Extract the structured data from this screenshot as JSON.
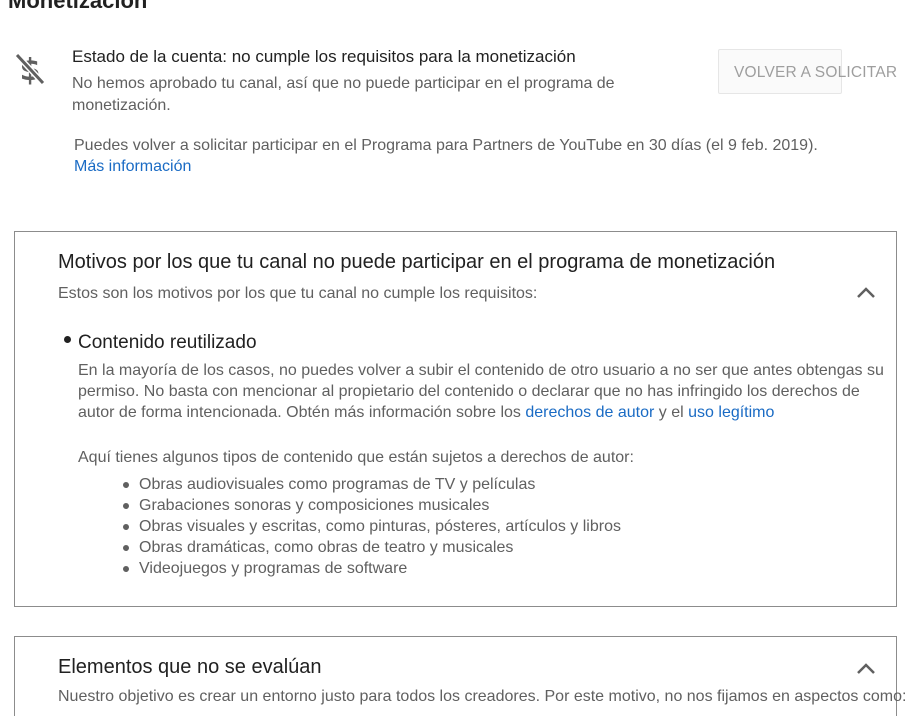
{
  "page": {
    "title": "Monetización"
  },
  "status": {
    "icon": "no-money-icon",
    "title": "Estado de la cuenta: no cumple los requisitos para la monetización",
    "description": "No hemos aprobado tu canal, así que no puede participar en el programa de monetización.",
    "reapply_label": "VOLVER A SOLICITAR",
    "reapply_note": "Puedes volver a solicitar participar en el Programa para Partners de YouTube en 30 días (el 9 feb. 2019).",
    "more_info_label": "Más información"
  },
  "reasons_card": {
    "title": "Motivos por los que tu canal no puede participar en el programa de monetización",
    "subtitle": "Estos son los motivos por los que tu canal no cumple los requisitos:",
    "reason": {
      "title": "Contenido reutilizado",
      "body": "En la mayoría de los casos, no puedes volver a subir el contenido de otro usuario a no ser que antes obtengas su permiso. No basta con mencionar al propietario del contenido o declarar que no has infringido los derechos de autor de forma intencionada. Obtén más información sobre los ",
      "copyright_link": "derechos de autor",
      "connector": " y el ",
      "fair_use_link": "uso legítimo",
      "examples_intro": "Aquí tienes algunos tipos de contenido que están sujetos a derechos de autor:",
      "examples": [
        "Obras audiovisuales como programas de TV y películas",
        "Grabaciones sonoras y composiciones musicales",
        "Obras visuales y escritas, como pinturas, pósteres, artículos y libros",
        "Obras dramáticas, como obras de teatro y musicales",
        "Videojuegos y programas de software"
      ]
    }
  },
  "not_evaluated_card": {
    "title": "Elementos que no se evalúan",
    "subtitle": "Nuestro objetivo es crear un entorno justo para todos los creadores. Por este motivo, no nos fijamos en aspectos como:"
  },
  "colors": {
    "link": "#1a6bc4",
    "secondary_text": "#606060",
    "primary_text": "#212121",
    "card_border": "#8c8c8c"
  }
}
